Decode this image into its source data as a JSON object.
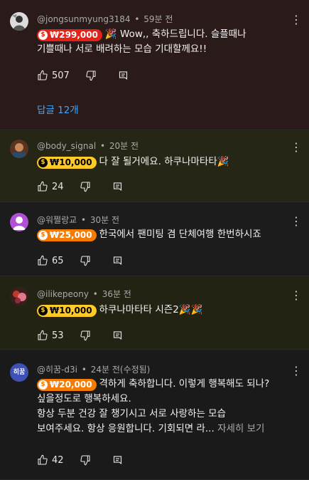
{
  "comments": [
    {
      "handle": "@jongsunmyung3184",
      "time": "59분 전",
      "amount": "₩299,000",
      "badge_color": "#e62117",
      "lines": [
        "🎉 Wow,, 축하드립니다. 슬플때나",
        "기쁠때나 서로 배려하는 모습 기대할께요!!"
      ],
      "likes": "507",
      "replies": "답글 12개"
    },
    {
      "handle": "@body_signal",
      "time": "20분 전",
      "amount": "₩10,000",
      "badge_color": "#ffca28",
      "lines": [
        "다 잘 될거에요. 하쿠나마타타🎉"
      ],
      "likes": "24"
    },
    {
      "handle": "@워쩔랑교",
      "time": "30분 전",
      "amount": "₩25,000",
      "badge_color": "#f57c00",
      "lines": [
        "한국에서 팬미팅 겸 단체여행 한번하시죠"
      ],
      "likes": "65"
    },
    {
      "handle": "@ilikepeony",
      "time": "36분 전",
      "amount": "₩10,000",
      "badge_color": "#ffca28",
      "lines": [
        "하쿠나마타타 시즌2🎉🎉"
      ],
      "likes": "53"
    },
    {
      "handle": "@히꿈-d3i",
      "time": "24분 전(수정됨)",
      "avatar_text": "히꿈",
      "amount": "₩20,000",
      "badge_color": "#f57c00",
      "lines": [
        "격하게 축하합니다. 이렇게 행복해도 되나?",
        "싶을정도로 행복하세요.",
        "항상 두분 건강 잘 챙기시고 서로 사랑하는 모습",
        "보여주세요. 항상 응원합니다. 기회되면 라..."
      ],
      "read_more": "자세히 보기",
      "likes": "42"
    }
  ],
  "icons": {
    "like": "thumb-up-icon",
    "dislike": "thumb-down-icon",
    "reply": "reply-icon",
    "more": "more-vert-icon",
    "coin": "super-thanks-coin-icon"
  }
}
